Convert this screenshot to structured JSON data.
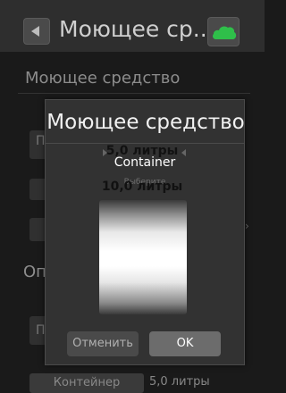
{
  "topbar": {
    "title": "Моющее ср..."
  },
  "background": {
    "section1": "Моющее средство",
    "row_stub_1": "П",
    "section2": "Оп",
    "row_stub_2": "П",
    "bottom_button": "Контейнер",
    "bottom_value": "5,0 литры"
  },
  "dialog": {
    "title": "Моющее средство",
    "subtitle": "Container",
    "hint": "Выберите",
    "options": [
      "5,0 литры",
      "10,0 литры"
    ],
    "selected": "5,0 литры",
    "cancel_label": "Отменить",
    "ok_label": "OK"
  },
  "colors": {
    "cloud_icon": "#2fbf4a",
    "dialog_bg": "#323232",
    "ok_button": "#6c6c6c"
  }
}
